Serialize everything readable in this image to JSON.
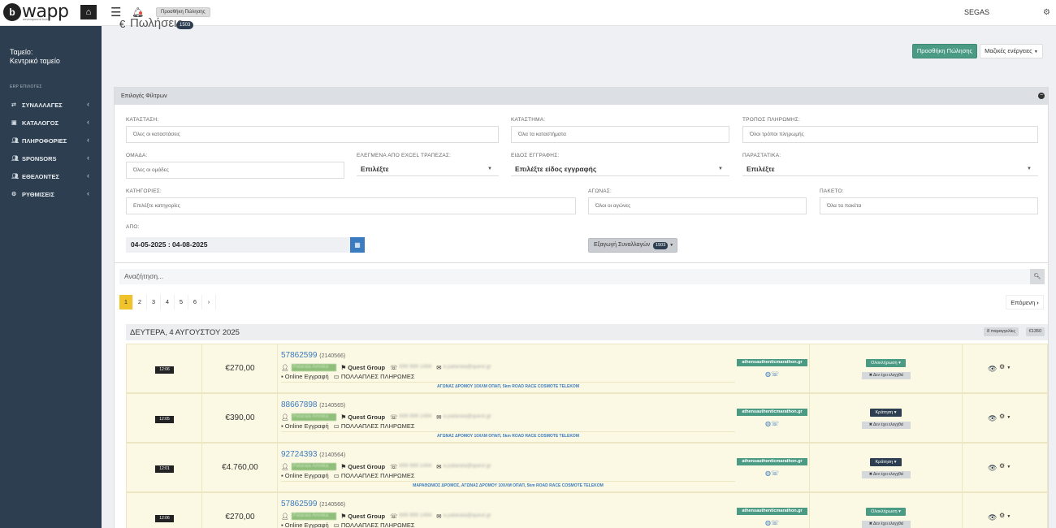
{
  "brand": {
    "logo_letter": "b",
    "logo_text": "wapp",
    "logo_sub": "development hub"
  },
  "topbar": {
    "add_sale_label": "Προσθήκη Πώλησης",
    "org_name": "SEGAS"
  },
  "sidebar": {
    "store_line1": "Ταμείο:",
    "store_line2": "Κεντρικό ταμείο",
    "section_label": "ERP ΕΠΙΛΟΓΕΣ",
    "items": [
      {
        "label": "ΣΥΝΑΛΛΑΓΕΣ",
        "icon": "exchange-icon"
      },
      {
        "label": "ΚΑΤΑΛΟΓΟΣ",
        "icon": "book-icon"
      },
      {
        "label": "ΠΛΗΡΟΦΟΡΙΕΣ",
        "icon": "users-icon"
      },
      {
        "label": "SPONSORS",
        "icon": "users-icon"
      },
      {
        "label": "ΕΘΕΛΟΝΤΕΣ",
        "icon": "users-icon"
      },
      {
        "label": "ΡΥΘΜΙΣΕΙΣ",
        "icon": "cogs-icon"
      }
    ]
  },
  "page": {
    "currency_symbol": "€",
    "title": "Πωλήσεις",
    "count": "1503",
    "add_sale_button": "Προσθήκη Πώλησης",
    "mass_actions_button": "Μαζικές ενέργειες"
  },
  "filters": {
    "panel_title": "Επιλογές Φίλτρων",
    "status": {
      "label": "ΚΑΤΑΣΤΑΣΗ:",
      "placeholder": "Όλες οι καταστάσεις"
    },
    "store": {
      "label": "ΚΑΤΑΣΤΗΜΑ:",
      "placeholder": "Όλα τα καταστήματα"
    },
    "payment": {
      "label": "ΤΡΟΠΟΣ ΠΛΗΡΩΜΗΣ:",
      "placeholder": "Όλοι τρόποι πληρωμής"
    },
    "group": {
      "label": "ΟΜΑΔΑ:",
      "placeholder": "Όλες οι ομάδες"
    },
    "excel": {
      "label": "ΕΛΕΓΜΕΝΑ ΑΠΟ EXCEL ΤΡΑΠΕΖΑΣ:",
      "value": "Επιλέξτε"
    },
    "reg_type": {
      "label": "ΕΙΔΟΣ ΕΓΓΡΑΦΗΣ:",
      "value": "Επιλέξτε είδος εγγραφής"
    },
    "receipts": {
      "label": "ΠΑΡΑΣΤΑΤΙΚΑ:",
      "value": "Επιλέξτε"
    },
    "categories": {
      "label": "ΚΑΤΗΓΟΡΙΕΣ:",
      "placeholder": "Επιλέξτε κατηγορίες"
    },
    "race": {
      "label": "ΑΓΩΝΑΣ:",
      "placeholder": "Όλοι οι αγώνες"
    },
    "package": {
      "label": "ΠΑΚΕΤΟ:",
      "placeholder": "Όλα τα πακέτα"
    },
    "from": {
      "label": "ΑΠΟ:",
      "value": "04-05-2025 : 04-08-2025"
    },
    "export_label": "Εξαγωγή Συναλλαγών",
    "export_count": "1503"
  },
  "search": {
    "placeholder": "Αναζήτηση..."
  },
  "pagination": {
    "pages": [
      "1",
      "2",
      "3",
      "4",
      "5",
      "6",
      "›"
    ],
    "active": "1",
    "next_label": "Επόμενη"
  },
  "day_group": {
    "title": "ΔΕΥΤΕΡΑ, 4 ΑΥΓΟΥΣΤΟΥ 2025",
    "orders_count": "8 παραγγελίες",
    "total": "€1350"
  },
  "rows": [
    {
      "time": "12:06",
      "amount": "€270,00",
      "order": "57862599",
      "order_id": "(2140566)",
      "name": "Pataraia Amnika",
      "group": "Quest Group",
      "phone": "699 999 1494",
      "email": "a.pataraia@quest.gr",
      "channel": "Online Εγγραφή",
      "payment": "ΠΟΛΛΑΠΛΕΣ ΠΛΗΡΩΜΕΣ",
      "race": "ΑΓΩΝΑΣ ΔΡΟΜΟΥ 10ΧΛΜ ΟΠΑΠ, 5km ROAD RACE COSMOTE TELEKOM",
      "site": "athensauthenticmarathon.gr",
      "status": "Ολοκλήρωση",
      "status_type": "ok",
      "check": "Δεν έχει ελεγχθεί"
    },
    {
      "time": "12:05",
      "amount": "€390,00",
      "order": "88667898",
      "order_id": "(2140565)",
      "name": "Pataraia Amnika",
      "group": "Quest Group",
      "phone": "699 999 1494",
      "email": "a.pataraia@quest.gr",
      "channel": "Online Εγγραφή",
      "payment": "ΠΟΛΛΑΠΛΕΣ ΠΛΗΡΩΜΕΣ",
      "race": "ΑΓΩΝΑΣ ΔΡΟΜΟΥ 10ΧΛΜ ΟΠΑΠ, 5km ROAD RACE COSMOTE TELEKOM",
      "site": "athensauthenticmarathon.gr",
      "status": "Κράτηση",
      "status_type": "kr",
      "check": "Δεν έχει ελεγχθεί"
    },
    {
      "time": "12:01",
      "amount": "€4.760,00",
      "order": "92724393",
      "order_id": "(2140564)",
      "name": "Pataraia Amnika",
      "group": "Quest Group",
      "phone": "699 999 1494",
      "email": "a.pataraia@quest.gr",
      "channel": "Online Εγγραφή",
      "payment": "ΠΟΛΛΑΠΛΕΣ ΠΛΗΡΩΜΕΣ",
      "race": "ΜΑΡΑΘΩΝΙΟΣ ΔΡΟΜΟΣ, ΑΓΩΝΑΣ ΔΡΟΜΟΥ 10ΧΛΜ ΟΠΑΠ, 5km ROAD RACE COSMOTE TELEKOM",
      "site": "athensauthenticmarathon.gr",
      "status": "Κράτηση",
      "status_type": "kr",
      "check": "Δεν έχει ελεγχθεί"
    },
    {
      "time": "12:06",
      "amount": "€270,00",
      "order": "57862599",
      "order_id": "(2140566)",
      "name": "Pataraia Amnika",
      "group": "Quest Group",
      "phone": "699 999 1494",
      "email": "a.pataraia@quest.gr",
      "channel": "Online Εγγραφή",
      "payment": "ΠΟΛΛΑΠΛΕΣ ΠΛΗΡΩΜΕΣ",
      "race": "ΑΓΩΝΑΣ ΔΡΟΜΟΥ 10ΧΛΜ ΟΠΑΠ, 5km ROAD RACE COSMOTE TELEKOM",
      "site": "athensauthenticmarathon.gr",
      "status": "Ολοκλήρωση",
      "status_type": "ok",
      "check": "Δεν έχει ελεγχθεί"
    }
  ]
}
